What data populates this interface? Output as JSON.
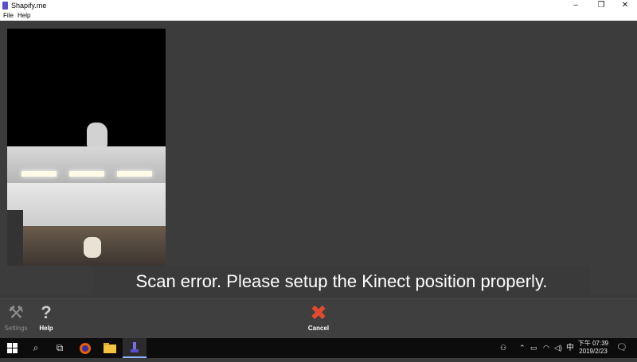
{
  "window": {
    "title": "Shapify.me",
    "minimize": "–",
    "restore": "❐",
    "close": "✕"
  },
  "menu": [
    {
      "label": "File"
    },
    {
      "label": "Help"
    }
  ],
  "message": "Scan error. Please setup the Kinect position properly.",
  "toolbar": {
    "settings_label": "Settings",
    "help_label": "Help",
    "help_icon": "?",
    "cancel_label": "Cancel",
    "cancel_icon": "✖",
    "settings_icon": "⚒",
    "settings_color": "#8c8c8c",
    "cancel_color": "#e24a2f"
  },
  "taskbar": {
    "start_icon": "windows-icon",
    "clock_time": "下午 07:39",
    "clock_date": "2019/2/23",
    "ime": "中"
  }
}
